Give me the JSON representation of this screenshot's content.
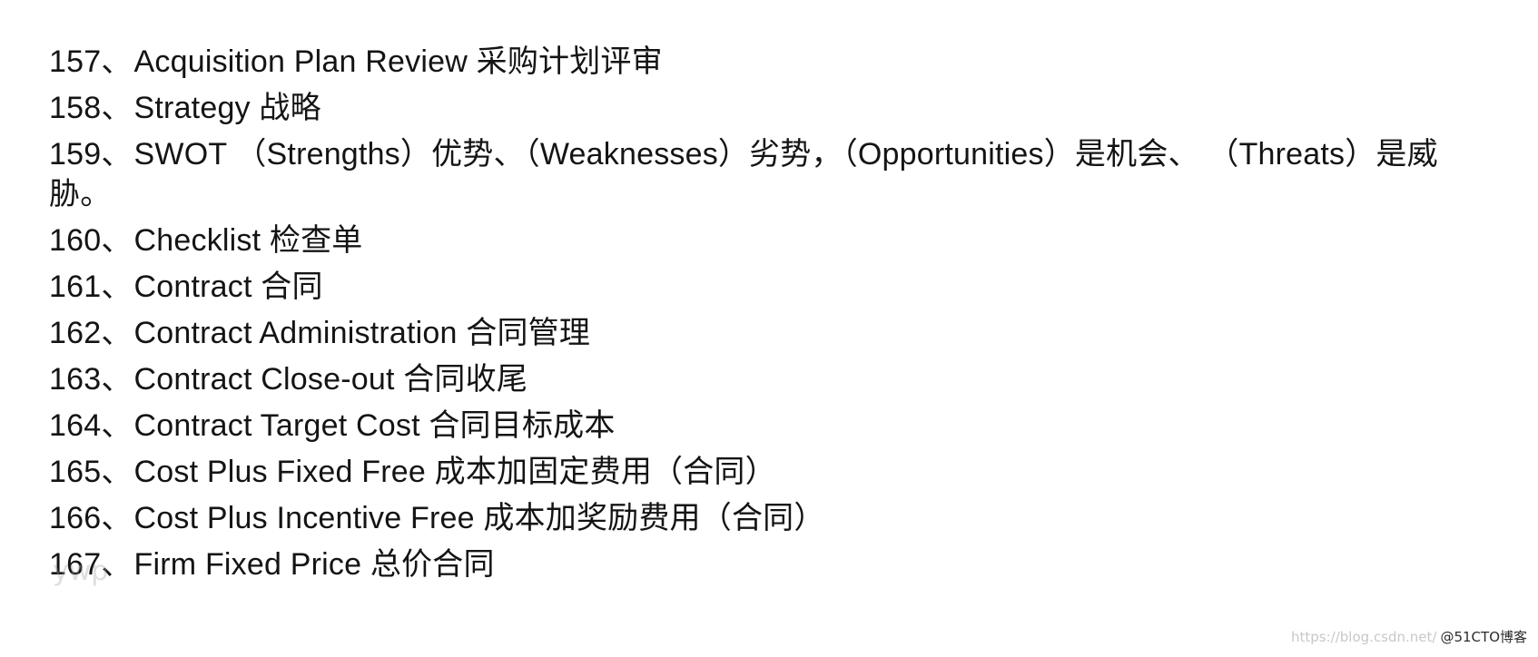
{
  "entries": [
    {
      "num": "157",
      "sep": "、",
      "text": "Acquisition Plan Review 采购计划评审"
    },
    {
      "num": "158",
      "sep": "、",
      "text": "Strategy 战略"
    },
    {
      "num": "159",
      "sep": "、",
      "text": "SWOT （Strengths）优势、（Weaknesses）劣势，（Opportunities）是机会、 （Threats）是威胁。"
    },
    {
      "num": "160",
      "sep": "、",
      "text": "Checklist 检查单"
    },
    {
      "num": "161",
      "sep": "、",
      "text": "Contract 合同"
    },
    {
      "num": "162",
      "sep": "、",
      "text": "Contract Administration 合同管理"
    },
    {
      "num": "163",
      "sep": "、",
      "text": "Contract Close-out 合同收尾"
    },
    {
      "num": "164",
      "sep": "、",
      "text": "Contract Target Cost 合同目标成本"
    },
    {
      "num": "165",
      "sep": "、",
      "text": "Cost Plus Fixed Free 成本加固定费用（合同）"
    },
    {
      "num": "166",
      "sep": "、",
      "text": "Cost Plus Incentive Free 成本加奖励费用（合同）"
    },
    {
      "num": "167",
      "sep": "、",
      "text": "Firm Fixed Price 总价合同"
    }
  ],
  "watermark": {
    "left": "ywp",
    "right_faint": "https://blog.csdn.net/",
    "right": "@51CTO博客"
  }
}
